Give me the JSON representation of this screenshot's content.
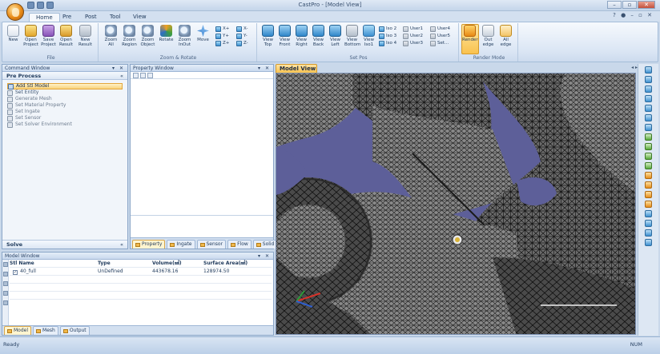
{
  "app": {
    "window_title": "CastPro - [Model View]",
    "tabs": [
      "Home",
      "Pre",
      "Post",
      "Tool",
      "View"
    ],
    "active_tab": "Home"
  },
  "ribbon": {
    "groups": [
      {
        "label": "File",
        "buttons": [
          {
            "label": "New",
            "icon": "new-file-icon"
          },
          {
            "label": "Open Project",
            "icon": "open-folder-icon"
          },
          {
            "label": "Save Project",
            "icon": "save-icon"
          },
          {
            "label": "Open Result",
            "icon": "open-result-icon"
          },
          {
            "label": "New Result",
            "icon": "new-result-icon"
          }
        ]
      },
      {
        "label": "Zoom & Rotate",
        "buttons": [
          {
            "label": "Zoom All",
            "icon": "zoom-all-icon"
          },
          {
            "label": "Zoom Region",
            "icon": "zoom-region-icon"
          },
          {
            "label": "Zoom Object",
            "icon": "zoom-object-icon"
          },
          {
            "label": "Rotate",
            "icon": "rotate-icon"
          },
          {
            "label": "Zoom InOut",
            "icon": "zoom-inout-icon"
          },
          {
            "label": "Move",
            "icon": "move-icon"
          }
        ],
        "small": [
          "X+",
          "Y+",
          "Z+",
          "X-",
          "Y-",
          "Z-"
        ]
      },
      {
        "label": "Set Pos",
        "buttons": [
          {
            "label": "View Top",
            "icon": "view-top-icon"
          },
          {
            "label": "View Front",
            "icon": "view-front-icon"
          },
          {
            "label": "View Right",
            "icon": "view-right-icon"
          },
          {
            "label": "View Back",
            "icon": "view-back-icon"
          },
          {
            "label": "View Left",
            "icon": "view-left-icon"
          },
          {
            "label": "View Bottom",
            "icon": "view-bottom-icon"
          },
          {
            "label": "View Iso1",
            "icon": "view-iso-icon"
          }
        ],
        "small": [
          "Iso 2",
          "Iso 3",
          "Iso 4",
          "User1",
          "User2",
          "User3",
          "User4",
          "User5",
          "Set..."
        ]
      },
      {
        "label": "Render Mode",
        "buttons": [
          {
            "label": "Render",
            "icon": "render-icon"
          },
          {
            "label": "Out edge",
            "icon": "out-edge-icon"
          },
          {
            "label": "All edge",
            "icon": "all-edge-icon"
          }
        ]
      }
    ]
  },
  "command_window": {
    "title": "Command Window",
    "section": "Pre Process",
    "steps": [
      {
        "label": "Add Stl Model",
        "active": true
      },
      {
        "label": "Set Entity",
        "active": false
      },
      {
        "label": "Generate Mesh",
        "active": false
      },
      {
        "label": "Set Material Property",
        "active": false
      },
      {
        "label": "Set Ingate",
        "active": false
      },
      {
        "label": "Set Sensor",
        "active": false
      },
      {
        "label": "Set Solver Environment",
        "active": false
      }
    ],
    "bottom_section": "Solve"
  },
  "property_window": {
    "title": "Property Window",
    "tabs": [
      "Property",
      "Ingate",
      "Sensor",
      "Flow",
      "Solid"
    ]
  },
  "model_window": {
    "title": "Model Window",
    "columns": [
      "Stl Name",
      "Type",
      "Volume(㎣)",
      "Surface Area(㎟)"
    ],
    "rows": [
      {
        "name": "40_full",
        "type": "UnDefined",
        "volume": "443678.16",
        "area": "128974.50",
        "checked": true
      }
    ],
    "tabs": [
      "Model",
      "Mesh",
      "Output"
    ]
  },
  "model_view": {
    "tab_label": "Model View"
  },
  "statusbar": {
    "left": "Ready",
    "right": "NUM"
  },
  "colors": {
    "viewport_bg": "#5d5f99",
    "accent": "#f9c24f"
  }
}
